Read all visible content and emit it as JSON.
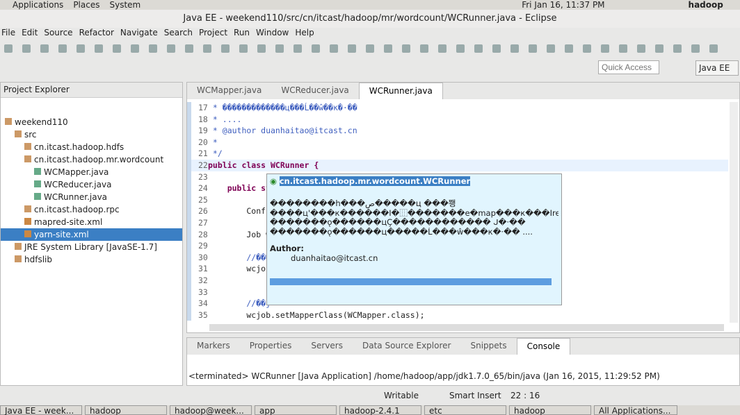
{
  "panel": {
    "menus": [
      "Applications",
      "Places",
      "System"
    ],
    "clock": "Fri Jan 16, 11:37 PM",
    "user": "hadoop"
  },
  "window": {
    "title": "Java EE - weekend110/src/cn/itcast/hadoop/mr/wordcount/WCRunner.java - Eclipse"
  },
  "menubar": [
    "File",
    "Edit",
    "Source",
    "Refactor",
    "Navigate",
    "Search",
    "Project",
    "Run",
    "Window",
    "Help"
  ],
  "quick_access": {
    "placeholder": "Quick Access"
  },
  "perspective": "Java EE",
  "explorer": {
    "title": "Project Explorer",
    "items": [
      {
        "label": "weekend110",
        "depth": 0,
        "icon": "project-icon"
      },
      {
        "label": "src",
        "depth": 1,
        "icon": "folder-icon"
      },
      {
        "label": "cn.itcast.hadoop.hdfs",
        "depth": 2,
        "icon": "package-icon"
      },
      {
        "label": "cn.itcast.hadoop.mr.wordcount",
        "depth": 2,
        "icon": "package-icon"
      },
      {
        "label": "WCMapper.java",
        "depth": 3,
        "icon": "java-file-icon"
      },
      {
        "label": "WCReducer.java",
        "depth": 3,
        "icon": "java-file-icon"
      },
      {
        "label": "WCRunner.java",
        "depth": 3,
        "icon": "java-file-icon"
      },
      {
        "label": "cn.itcast.hadoop.rpc",
        "depth": 2,
        "icon": "package-icon"
      },
      {
        "label": "mapred-site.xml",
        "depth": 2,
        "icon": "xml-file-icon"
      },
      {
        "label": "yarn-site.xml",
        "depth": 2,
        "icon": "xml-file-icon",
        "selected": true
      },
      {
        "label": "JRE System Library [JavaSE-1.7]",
        "depth": 1,
        "icon": "library-icon"
      },
      {
        "label": "hdfslib",
        "depth": 1,
        "icon": "library-icon"
      }
    ]
  },
  "editor": {
    "tabs": [
      "WCMapper.java",
      "WCReducer.java",
      "WCRunner.java"
    ],
    "active_tab": 2,
    "lines": [
      {
        "n": "17",
        "t": " * �������������ц���Ĺ��ŵ��к�·��"
      },
      {
        "n": "18",
        "t": " * ...."
      },
      {
        "n": "19",
        "t": " * @author duanhaitao@itcast.cn"
      },
      {
        "n": "20",
        "t": " *"
      },
      {
        "n": "21",
        "t": " */"
      },
      {
        "n": "22",
        "t": "public class WCRunner {"
      },
      {
        "n": "23",
        "t": ""
      },
      {
        "n": "24",
        "t": "    public st"
      },
      {
        "n": "25",
        "t": ""
      },
      {
        "n": "26",
        "t": "        Confi"
      },
      {
        "n": "27",
        "t": ""
      },
      {
        "n": "28",
        "t": "        Job w"
      },
      {
        "n": "29",
        "t": ""
      },
      {
        "n": "30",
        "t": "        //���"
      },
      {
        "n": "31",
        "t": "        wcjob"
      },
      {
        "n": "32",
        "t": ""
      },
      {
        "n": "33",
        "t": ""
      },
      {
        "n": "34",
        "t": "        //��j"
      },
      {
        "n": "35",
        "t": "        wcjob.setMapperClass(WCMapper.class);"
      }
    ]
  },
  "hover": {
    "title": "cn.itcast.hadoop.mr.wordcount.WCRunner",
    "body": [
      "��������h���ص�����ц ���쬉",
      "����ц'���к������Ӏ�⿲�������e�map���к���Ireduce",
      "�������ǫ������цÇ������������ ᒍ�·��",
      "�������ǫ������ц�����Ĺ���ŵ���к�·�� ...."
    ],
    "author_label": "Author:",
    "author": "duanhaitao@itcast.cn"
  },
  "bottom": {
    "tabs": [
      "Markers",
      "Properties",
      "Servers",
      "Data Source Explorer",
      "Snippets",
      "Console"
    ],
    "active_tab": 5,
    "console_text": "<terminated> WCRunner [Java Application] /home/hadoop/app/jdk1.7.0_65/bin/java (Jan 16, 2015, 11:29:52 PM)"
  },
  "status": {
    "mode": "Writable",
    "insert": "Smart Insert",
    "position": "22 : 16"
  },
  "taskbar": [
    "Java EE - week...",
    "hadoop",
    "hadoop@week...",
    "app",
    "hadoop-2.4.1",
    "etc",
    "hadoop",
    "All Applications..."
  ]
}
